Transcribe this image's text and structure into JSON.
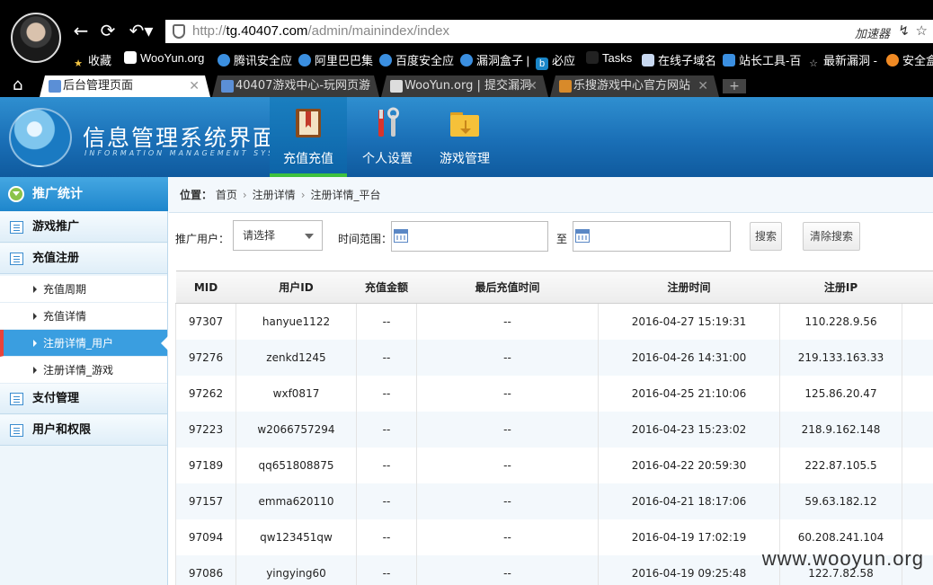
{
  "browser": {
    "url_prefix": "http://",
    "url_host": "tg.40407.com",
    "url_path": "/admin/mainindex/index",
    "accelerator_label": "加速器",
    "bookmarks": [
      {
        "label": "收藏",
        "icon": "star-icon",
        "color": "#f4c542"
      },
      {
        "label": "WooYun.org",
        "icon": "wooyun-icon",
        "color": "#ffffff"
      },
      {
        "label": "腾讯安全应",
        "icon": "tencent-icon",
        "color": "#3b8fe0"
      },
      {
        "label": "阿里巴巴集",
        "icon": "alibaba-icon",
        "color": "#3b8fe0"
      },
      {
        "label": "百度安全应",
        "icon": "baidu-icon",
        "color": "#3b8fe0"
      },
      {
        "label": "漏洞盒子 |",
        "icon": "vulbox-icon",
        "color": "#3b8fe0"
      },
      {
        "label": "必应",
        "icon": "bing-icon",
        "color": "#1a86c8"
      },
      {
        "label": "Tasks",
        "icon": "tasks-icon",
        "color": "#222222"
      },
      {
        "label": "在线子域名",
        "icon": "page-icon",
        "color": "#c8d8f0"
      },
      {
        "label": "站长工具-百",
        "icon": "chinaz-icon",
        "color": "#3b8fe0"
      },
      {
        "label": "最新漏洞 -",
        "icon": "star-outline-icon",
        "color": "#cccccc"
      },
      {
        "label": "安全盒",
        "icon": "safebox-icon",
        "color": "#f08a24"
      }
    ],
    "tabs": [
      {
        "label": "后台管理页面",
        "active": true,
        "color": "#5b8fd6"
      },
      {
        "label": "40407游戏中心-玩网页游",
        "active": false,
        "color": "#5b8fd6"
      },
      {
        "label": "WooYun.org | 提交漏洞",
        "active": false,
        "color": "#dddddd"
      },
      {
        "label": "乐搜游戏中心官方网站",
        "active": false,
        "color": "#d88a2a"
      }
    ]
  },
  "app": {
    "title": "信息管理系统界面",
    "subtitle": "INFORMATION MANAGEMENT SYSTEM GUI",
    "topnav": [
      {
        "label": "充值充值",
        "icon": "book-icon",
        "active": true
      },
      {
        "label": "个人设置",
        "icon": "tools-icon",
        "active": false
      },
      {
        "label": "游戏管理",
        "icon": "folder-icon",
        "active": false
      }
    ]
  },
  "sidebar": {
    "header": "推广统计",
    "sections": [
      {
        "label": "游戏推广"
      },
      {
        "label": "充值注册"
      },
      {
        "label": "支付管理"
      },
      {
        "label": "用户和权限"
      }
    ],
    "sub_items": [
      {
        "label": "充值周期"
      },
      {
        "label": "充值详情"
      },
      {
        "label": "注册详情_用户"
      },
      {
        "label": "注册详情_游戏"
      }
    ]
  },
  "breadcrumb": {
    "prefix": "位置：",
    "items": [
      "首页",
      "注册详情",
      "注册详情_平台"
    ]
  },
  "filters": {
    "user_label": "推广用户：",
    "user_select": "请选择",
    "range_label": "时间范围：",
    "to_label": "至",
    "search_button": "搜索",
    "clear_button": "清除搜索"
  },
  "table": {
    "headers": [
      "MID",
      "用户ID",
      "充值金额",
      "最后充值时间",
      "注册时间",
      "注册IP"
    ],
    "rows": [
      [
        "97307",
        "hanyue1122",
        "--",
        "--",
        "2016-04-27 15:19:31",
        "110.228.9.56"
      ],
      [
        "97276",
        "zenkd1245",
        "--",
        "--",
        "2016-04-26 14:31:00",
        "219.133.163.33"
      ],
      [
        "97262",
        "wxf0817",
        "--",
        "--",
        "2016-04-25 21:10:06",
        "125.86.20.47"
      ],
      [
        "97223",
        "w2066757294",
        "--",
        "--",
        "2016-04-23 15:23:02",
        "218.9.162.148"
      ],
      [
        "97189",
        "qq651808875",
        "--",
        "--",
        "2016-04-22 20:59:30",
        "222.87.105.5"
      ],
      [
        "97157",
        "emma620110",
        "--",
        "--",
        "2016-04-21 18:17:06",
        "59.63.182.12"
      ],
      [
        "97094",
        "qw123451qw",
        "--",
        "--",
        "2016-04-19 17:02:19",
        "60.208.241.104"
      ],
      [
        "97086",
        "yingying60",
        "--",
        "--",
        "2016-04-19 09:25:48",
        "122.7.82.58"
      ]
    ]
  },
  "watermark": "www.wooyun.org"
}
